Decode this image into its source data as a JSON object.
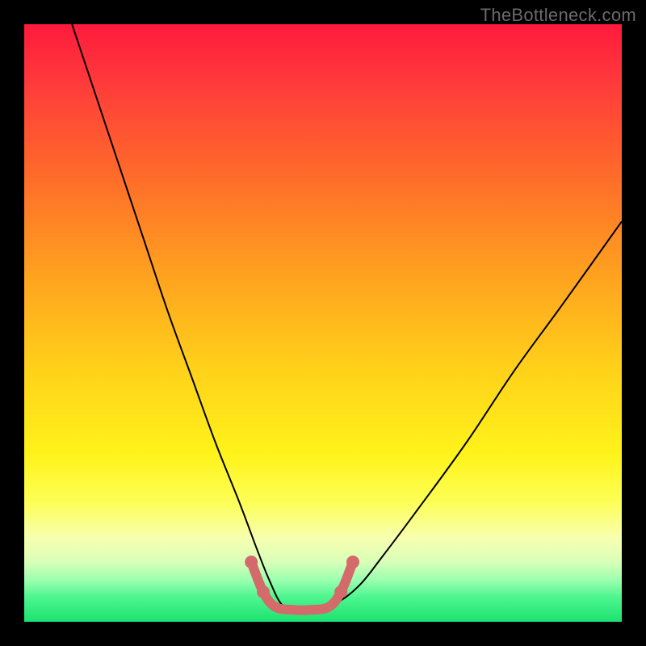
{
  "watermark": "TheBottleneck.com",
  "chart_data": {
    "type": "line",
    "title": "",
    "xlabel": "",
    "ylabel": "",
    "xlim": [
      0,
      100
    ],
    "ylim": [
      0,
      100
    ],
    "background_gradient_stops": [
      {
        "pos": 0.0,
        "color": "#ff1a3c"
      },
      {
        "pos": 0.1,
        "color": "#ff3b3b"
      },
      {
        "pos": 0.25,
        "color": "#ff6a2a"
      },
      {
        "pos": 0.42,
        "color": "#ffa21f"
      },
      {
        "pos": 0.58,
        "color": "#ffd21a"
      },
      {
        "pos": 0.72,
        "color": "#fff31a"
      },
      {
        "pos": 0.8,
        "color": "#fdff57"
      },
      {
        "pos": 0.86,
        "color": "#f7ffb0"
      },
      {
        "pos": 0.9,
        "color": "#d9ffb8"
      },
      {
        "pos": 0.93,
        "color": "#9bffb0"
      },
      {
        "pos": 0.96,
        "color": "#4bf58f"
      },
      {
        "pos": 1.0,
        "color": "#1de26f"
      }
    ],
    "series": [
      {
        "name": "bottleneck-curve",
        "stroke": "#000000",
        "stroke_width": 2,
        "x": [
          8,
          12,
          16,
          20,
          24,
          28,
          32,
          36,
          39,
          41,
          43,
          45,
          48,
          52,
          56,
          60,
          66,
          74,
          82,
          90,
          100
        ],
        "y": [
          100,
          88,
          76,
          64,
          52,
          41,
          30,
          20,
          12,
          7,
          3,
          2,
          2,
          3,
          6,
          11,
          19,
          30,
          42,
          53,
          67
        ]
      },
      {
        "name": "optimal-band",
        "stroke": "#d46a6a",
        "stroke_width": 12,
        "linecap": "round",
        "x": [
          38,
          40,
          42,
          45,
          48,
          51,
          53,
          55
        ],
        "y": [
          10,
          5,
          2.5,
          2,
          2,
          2.5,
          5,
          10
        ]
      }
    ],
    "optimal_marker_dots": {
      "color": "#d46a6a",
      "radius": 8,
      "points": [
        {
          "x": 38,
          "y": 10
        },
        {
          "x": 40,
          "y": 5
        },
        {
          "x": 53,
          "y": 5
        },
        {
          "x": 55,
          "y": 10
        }
      ]
    }
  }
}
